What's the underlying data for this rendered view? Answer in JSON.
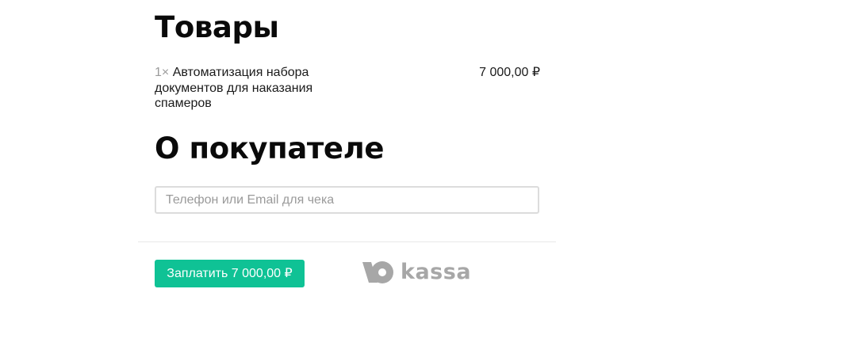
{
  "goods": {
    "title": "Товары",
    "items": [
      {
        "quantity": "1×",
        "name": "Автоматизация набора документов для наказания спамеров",
        "price": "7 000,00 ₽"
      }
    ]
  },
  "buyer": {
    "title": "О покупателе",
    "contact_placeholder": "Телефон или Email для чека",
    "contact_value": ""
  },
  "payment": {
    "pay_button_label": "Заплатить 7 000,00 ₽",
    "accent_color": "#0fc295"
  },
  "provider": {
    "logo_text": "kassa",
    "logo_color": "#a7a7a7"
  }
}
